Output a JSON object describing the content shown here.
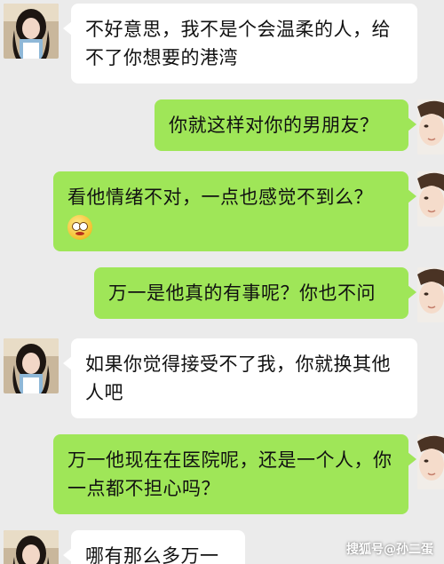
{
  "messages": [
    {
      "side": "in",
      "text": "不好意思，我不是个会温柔的人，给不了你想要的港湾"
    },
    {
      "side": "out",
      "text": "你就这样对你的男朋友？"
    },
    {
      "side": "out",
      "text": "看他情绪不对，一点也感觉不到么？",
      "emoji": "flushed-face-emoji"
    },
    {
      "side": "out",
      "text": "万一是他真的有事呢？你也不问"
    },
    {
      "side": "in",
      "text": "如果你觉得接受不了我，你就换其他人吧"
    },
    {
      "side": "out",
      "text": "万一他现在在医院呢，还是一个人，你一点都不担心吗？"
    },
    {
      "side": "in",
      "text": "哪有那么多万一"
    }
  ],
  "watermark": "搜狐号@孙二蛋",
  "colors": {
    "background": "#ebebeb",
    "incoming_bubble": "#ffffff",
    "outgoing_bubble": "#9fe658"
  },
  "icons": {
    "left_avatar": "girl-avatar",
    "right_avatar": "boy-avatar"
  }
}
